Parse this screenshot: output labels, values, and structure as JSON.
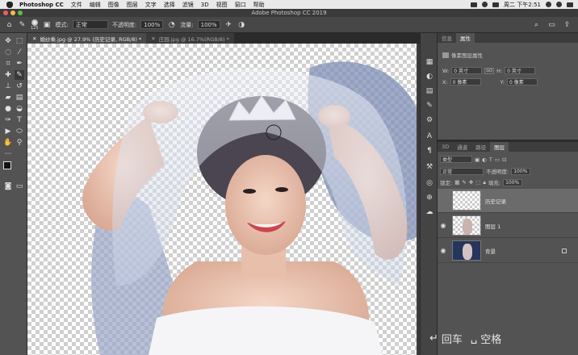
{
  "menubar": {
    "app_name": "Photoshop CC",
    "items": [
      "文件",
      "编辑",
      "图像",
      "图层",
      "文字",
      "选择",
      "滤镜",
      "3D",
      "视图",
      "窗口",
      "帮助"
    ],
    "clock": "周二 下午2:51"
  },
  "window": {
    "title": "Adobe Photoshop CC 2019"
  },
  "options_bar": {
    "brush_size": "125",
    "mode_label": "模式:",
    "mode_value": "正常",
    "opacity_label": "不透明度:",
    "opacity_value": "100%",
    "flow_label": "流量:",
    "flow_value": "100%"
  },
  "doc_tabs": [
    {
      "label": "婚纱乘.jpg @ 27.9% (历史记录, RGB/8) *",
      "active": true
    },
    {
      "label": "庄园.jpg @ 16.7%(RGB/8) *",
      "active": false
    }
  ],
  "properties_panel": {
    "tabs": [
      "信息",
      "属性"
    ],
    "active_tab": "属性",
    "header": "像素图层属性",
    "w_label": "W:",
    "w_value": "0 英寸",
    "h_label": "H:",
    "h_value": "0 英寸",
    "x_label": "X:",
    "x_value": "0 像素",
    "y_label": "Y:",
    "y_value": "0 像素",
    "link_label": "GO"
  },
  "layers_panel": {
    "tabs": [
      "3D",
      "通道",
      "路径",
      "图层"
    ],
    "active_tab": "图层",
    "filter_label": "类型",
    "blend_mode": "正常",
    "opacity_label": "不透明度:",
    "opacity_value": "100%",
    "lock_label": "锁定:",
    "fill_label": "填充:",
    "fill_value": "100%",
    "layers": [
      {
        "name": "历史记录",
        "selected": true,
        "visible": false,
        "locked": false
      },
      {
        "name": "图层 1",
        "selected": false,
        "visible": true,
        "locked": false
      },
      {
        "name": "背景",
        "selected": false,
        "visible": true,
        "locked": true
      }
    ]
  },
  "overlay": {
    "enter_label": "回车",
    "space_label": "空格"
  },
  "colors": {
    "panel": "#535353",
    "dark": "#2b2b2b",
    "selected_layer": "#6b6b6b"
  }
}
